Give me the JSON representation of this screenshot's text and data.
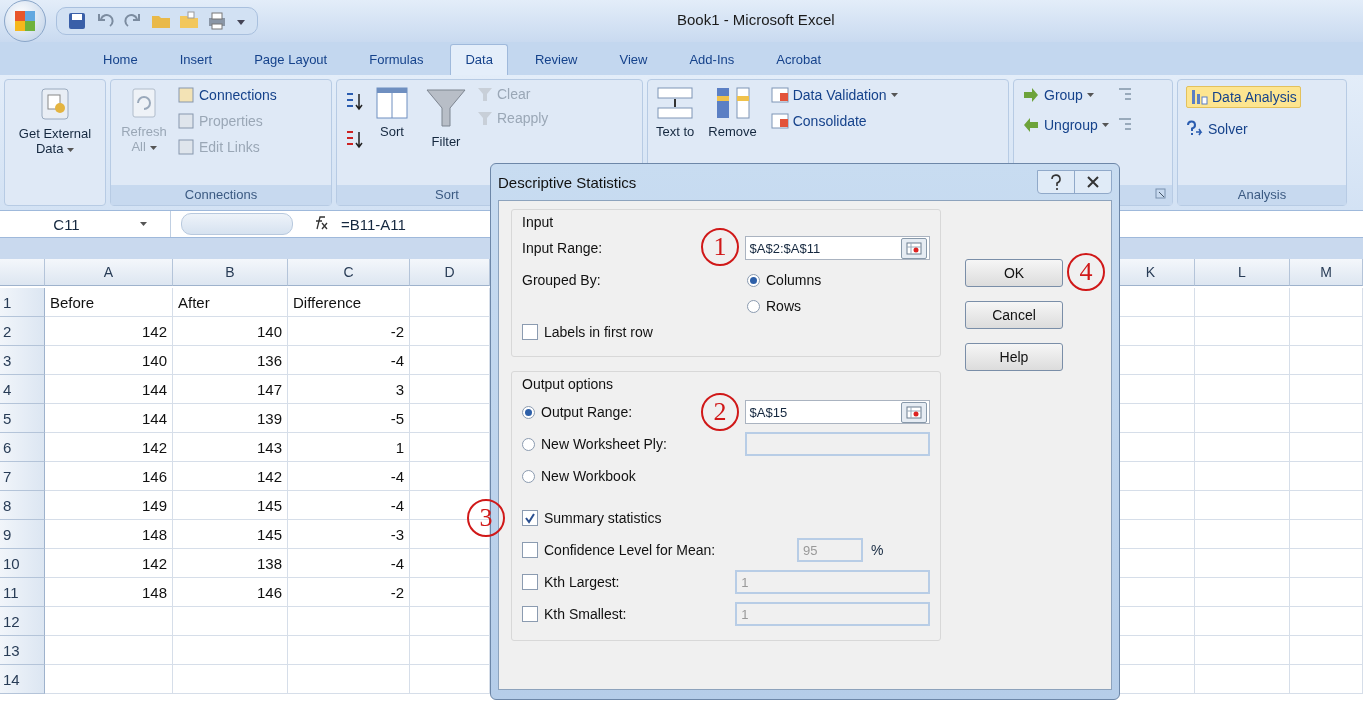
{
  "window": {
    "title": "Book1 - Microsoft Excel"
  },
  "tabs": [
    {
      "label": "Home",
      "selected": false
    },
    {
      "label": "Insert",
      "selected": false
    },
    {
      "label": "Page Layout",
      "selected": false
    },
    {
      "label": "Formulas",
      "selected": false
    },
    {
      "label": "Data",
      "selected": true
    },
    {
      "label": "Review",
      "selected": false
    },
    {
      "label": "View",
      "selected": false
    },
    {
      "label": "Add-Ins",
      "selected": false
    },
    {
      "label": "Acrobat",
      "selected": false
    }
  ],
  "ribbon": {
    "get_external_data": {
      "label": "Get External Data"
    },
    "connections": {
      "refresh": {
        "label": "Refresh All",
        "disabled": true
      },
      "items": [
        {
          "label": "Connections",
          "disabled": false
        },
        {
          "label": "Properties",
          "disabled": true
        },
        {
          "label": "Edit Links",
          "disabled": true
        }
      ],
      "label": "Connections"
    },
    "sort_filter": {
      "sort": "Sort",
      "filter": "Filter",
      "items": [
        {
          "label": "Clear",
          "disabled": true
        },
        {
          "label": "Reapply",
          "disabled": true
        }
      ],
      "label": "Sort"
    },
    "data_tools": {
      "text_to": "Text to",
      "remove": "Remove",
      "items": [
        {
          "label": "Data Validation"
        },
        {
          "label": "Consolidate"
        }
      ]
    },
    "outline": {
      "items": [
        {
          "label": "Group"
        },
        {
          "label": "Ungroup"
        }
      ]
    },
    "analysis": {
      "items": [
        {
          "label": "Data Analysis",
          "selected": true
        },
        {
          "label": "Solver",
          "selected": false
        }
      ],
      "label": "Analysis"
    }
  },
  "formula_bar": {
    "name_box": "C11",
    "formula": "=B11-A11"
  },
  "sheet": {
    "columns": [
      "A",
      "B",
      "C",
      "D",
      "K",
      "L",
      "M"
    ],
    "rows": [
      {
        "number": "1",
        "kind": "text",
        "cells": [
          "Before",
          "After",
          "Difference"
        ]
      },
      {
        "number": "2",
        "kind": "number",
        "cells": [
          "142",
          "140",
          "-2"
        ]
      },
      {
        "number": "3",
        "kind": "number",
        "cells": [
          "140",
          "136",
          "-4"
        ]
      },
      {
        "number": "4",
        "kind": "number",
        "cells": [
          "144",
          "147",
          "3"
        ]
      },
      {
        "number": "5",
        "kind": "number",
        "cells": [
          "144",
          "139",
          "-5"
        ]
      },
      {
        "number": "6",
        "kind": "number",
        "cells": [
          "142",
          "143",
          "1"
        ]
      },
      {
        "number": "7",
        "kind": "number",
        "cells": [
          "146",
          "142",
          "-4"
        ]
      },
      {
        "number": "8",
        "kind": "number",
        "cells": [
          "149",
          "145",
          "-4"
        ]
      },
      {
        "number": "9",
        "kind": "number",
        "cells": [
          "148",
          "145",
          "-3"
        ]
      },
      {
        "number": "10",
        "kind": "number",
        "cells": [
          "142",
          "138",
          "-4"
        ]
      },
      {
        "number": "11",
        "kind": "number",
        "cells": [
          "148",
          "146",
          "-2"
        ]
      },
      {
        "number": "12",
        "kind": "number",
        "cells": []
      },
      {
        "number": "13",
        "kind": "number",
        "cells": []
      },
      {
        "number": "14",
        "kind": "number",
        "cells": []
      }
    ]
  },
  "dialog": {
    "title": "Descriptive Statistics",
    "input": {
      "legend": "Input",
      "range_label": "Input Range:",
      "range_value": "$A$2:$A$11",
      "callout": "1",
      "grouped_label": "Grouped By:",
      "grouped": [
        {
          "label": "Columns",
          "selected": true
        },
        {
          "label": "Rows",
          "selected": false
        }
      ],
      "labels_first_row": {
        "label": "Labels in first row",
        "checked": false
      }
    },
    "output": {
      "legend": "Output options",
      "destinations": [
        {
          "label": "Output Range:",
          "selected": true,
          "kind": "range",
          "value": "$A$15",
          "callout": "2"
        },
        {
          "label": "New Worksheet Ply:",
          "selected": false,
          "kind": "text"
        },
        {
          "label": "New Workbook",
          "selected": false,
          "kind": "none"
        }
      ],
      "options": [
        {
          "label": "Summary statistics",
          "checked": true,
          "callout": "3"
        },
        {
          "label": "Confidence Level for Mean:",
          "checked": false,
          "value": "95",
          "unit": "%",
          "kind": "short"
        },
        {
          "label": "Kth Largest:",
          "checked": false,
          "value": "1",
          "kind": "long"
        },
        {
          "label": "Kth Smallest:",
          "checked": false,
          "value": "1",
          "kind": "long"
        }
      ]
    },
    "buttons": [
      {
        "label": "OK",
        "callout": "4"
      },
      {
        "label": "Cancel"
      },
      {
        "label": "Help"
      }
    ]
  }
}
